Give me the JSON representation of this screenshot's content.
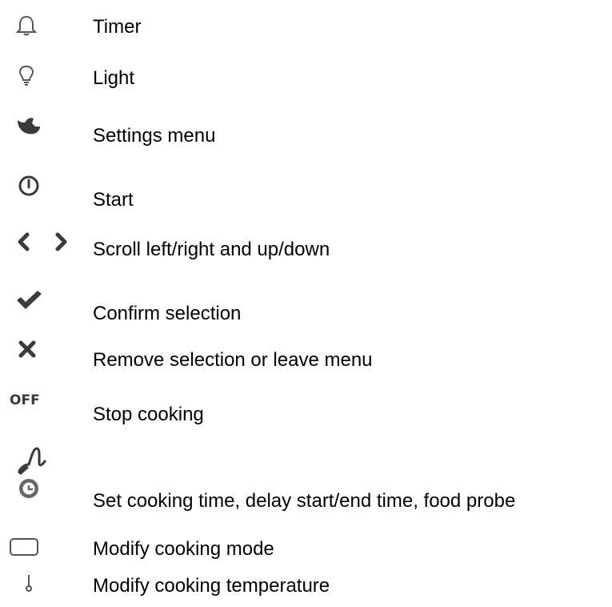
{
  "legend": [
    {
      "icon": "bell-icon",
      "label": "Timer"
    },
    {
      "icon": "light-bulb-icon",
      "label": "Light"
    },
    {
      "icon": "wrench-icon",
      "label": "Settings menu"
    },
    {
      "icon": "power-icon",
      "label": "Start"
    },
    {
      "icon": "chevron-left-right-icon",
      "label": "Scroll left/right and up/down"
    },
    {
      "icon": "checkmark-icon",
      "label": "Confirm selection"
    },
    {
      "icon": "close-icon",
      "label": "Remove selection or leave menu"
    },
    {
      "icon": "off-icon",
      "label": "Stop cooking",
      "icon_text": "OFF"
    },
    {
      "icon": "food-probe-clock-icon",
      "label": "Set cooking time, delay start/end time, food probe"
    },
    {
      "icon": "cooking-mode-icon",
      "label": "Modify cooking mode"
    },
    {
      "icon": "thermometer-icon",
      "label": "Modify cooking temperature"
    }
  ],
  "colors": {
    "icon_gray": "#555555",
    "icon_dark": "#3a3a3a"
  }
}
